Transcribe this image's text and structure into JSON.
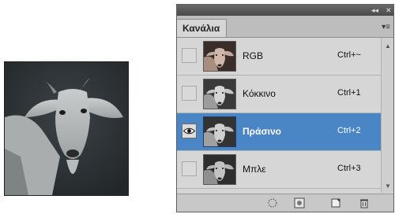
{
  "panel": {
    "tab_label": "Κανάλια",
    "collapse_glyph": "◂◂",
    "close_glyph": "✕",
    "menu_glyph": "▾≡"
  },
  "channels": [
    {
      "name": "RGB",
      "shortcut": "Ctrl+~",
      "visible": false,
      "selected": false
    },
    {
      "name": "Κόκκινο",
      "shortcut": "Ctrl+1",
      "visible": false,
      "selected": false
    },
    {
      "name": "Πράσινο",
      "shortcut": "Ctrl+2",
      "visible": true,
      "selected": true
    },
    {
      "name": "Μπλε",
      "shortcut": "Ctrl+3",
      "visible": false,
      "selected": false
    }
  ],
  "toolbar": {
    "icons": [
      "load-selection-icon",
      "save-selection-icon",
      "new-channel-icon",
      "delete-channel-icon"
    ]
  },
  "colors": {
    "selection": "#4a86c5",
    "panel_bg": "#d6d6d6"
  }
}
